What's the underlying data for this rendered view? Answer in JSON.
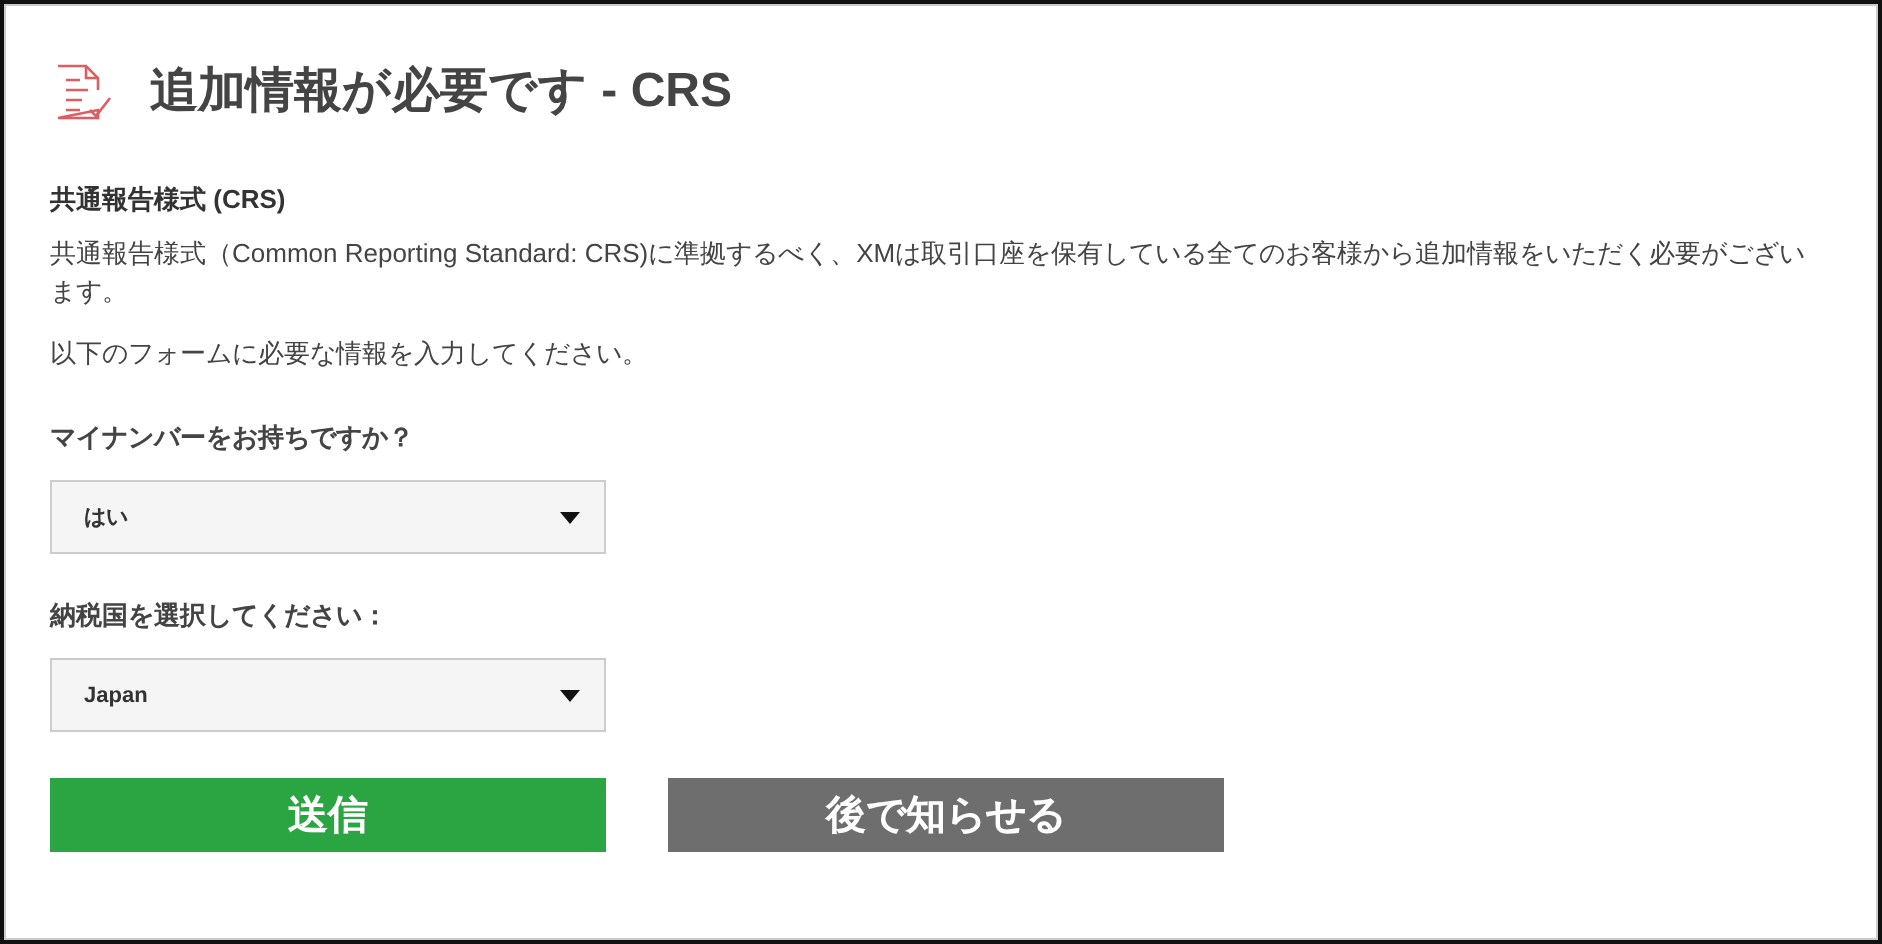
{
  "header": {
    "title": "追加情報が必要です - CRS"
  },
  "section": {
    "heading": "共通報告様式 (CRS)",
    "paragraphs": [
      "共通報告様式（Common Reporting Standard: CRS)に準拠するべく、XMは取引口座を保有している全てのお客様から追加情報をいただく必要がございます。",
      "以下のフォームに必要な情報を入力してください。"
    ]
  },
  "fields": [
    {
      "label": "マイナンバーをお持ちですか？",
      "value": "はい"
    },
    {
      "label": "納税国を選択してください：",
      "value": "Japan"
    }
  ],
  "buttons": [
    {
      "label": "送信",
      "kind": "primary"
    },
    {
      "label": "後で知らせる",
      "kind": "secondary"
    }
  ]
}
